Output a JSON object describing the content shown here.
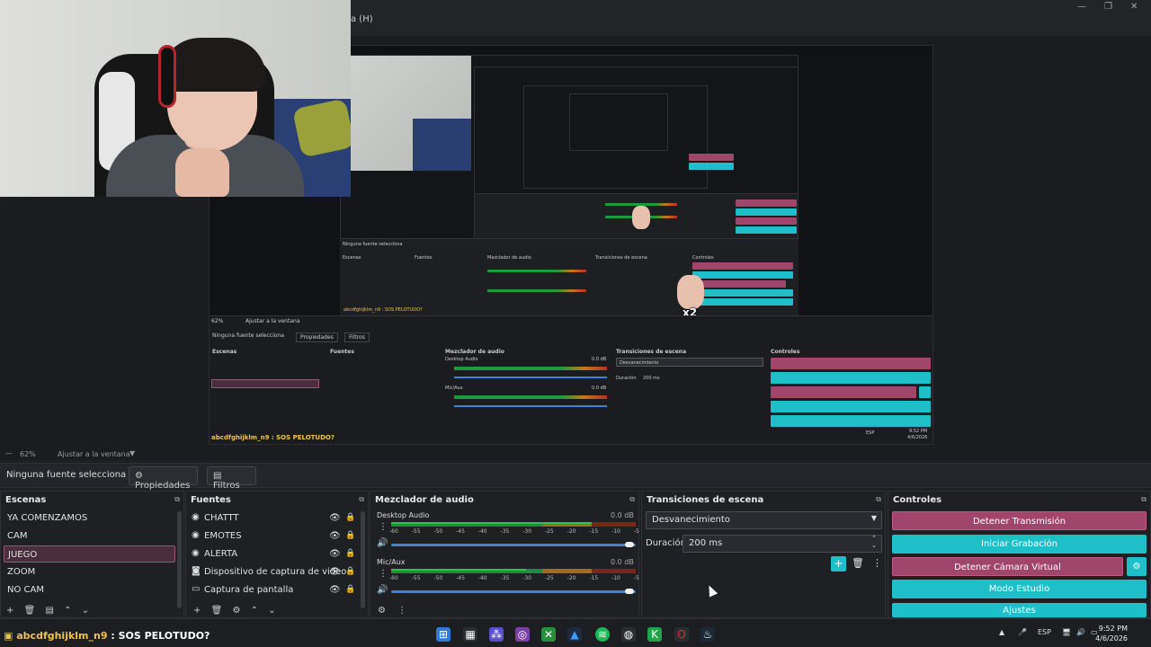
{
  "window": {
    "menu_help": "a (H)",
    "controls": [
      "—",
      "❐",
      "✕"
    ]
  },
  "zoombar": {
    "zoom": "62%",
    "fit": "Ajustar a la ventana"
  },
  "propbar": {
    "no_source": "Ninguna fuente selecciona",
    "properties": "Propiedades",
    "filters": "Filtros"
  },
  "scenes": {
    "title": "Escenas",
    "items": [
      "YA COMENZAMOS",
      "CAM",
      "JUEGO",
      "ZOOM",
      "NO CAM"
    ],
    "selected": "JUEGO"
  },
  "sources": {
    "title": "Fuentes",
    "items": [
      {
        "label": "CHATTT",
        "icon": "browser-icon"
      },
      {
        "label": "EMOTES",
        "icon": "browser-icon"
      },
      {
        "label": "ALERTA",
        "icon": "browser-icon"
      },
      {
        "label": "Dispositivo de captura de video",
        "icon": "camera-icon"
      },
      {
        "label": "Captura de pantalla",
        "icon": "monitor-icon"
      }
    ]
  },
  "mixer": {
    "title": "Mezclador de audio",
    "channels": [
      {
        "name": "Desktop Audio",
        "db": "0.0 dB",
        "level": 0.82
      },
      {
        "name": "Mic/Aux",
        "db": "0.0 dB",
        "level": 0.55
      }
    ],
    "ticks": "-60 -55 -50 -45 -40 -35 -30 -25 -20 -15 -10 -5 0"
  },
  "transitions": {
    "title": "Transiciones de escena",
    "selected": "Desvanecimiento",
    "duration_label": "Duración",
    "duration_value": "200 ms"
  },
  "controls": {
    "title": "Controles",
    "stop_stream": "Detener Transmisión",
    "start_record": "Iniciar Grabación",
    "stop_virtual_cam": "Detener Cámara Virtual",
    "studio_mode": "Modo Estudio",
    "settings": "Ajustes"
  },
  "nested": {
    "no_source": "Ninguna fuente selecciona",
    "properties": "Propiedades",
    "filters": "Filtros",
    "scenes": "Escenas",
    "sources": "Fuentes",
    "mixer": "Mezclador de audio",
    "transitions": "Transiciones de escena",
    "controls": "Controles",
    "desktop_audio": "Desktop Audio",
    "mic": "Mic/Aux",
    "db": "0.0 dB",
    "duration": "Duración",
    "duration_value": "200 ms",
    "transition": "Desvanecimiento",
    "zoom": "62%",
    "fit": "Ajustar a la ventana",
    "sticker_label": "x2",
    "chat": "abcdfghijklm_n9 : SOS PELOTUDO?",
    "clock_time": "9:52 PM",
    "clock_date": "4/6/2026",
    "lang": "ESP"
  },
  "taskbar": {
    "chat_user": "abcdfghijklm_n9",
    "chat_msg": " : SOS PELOTUDO?",
    "lang": "ESP",
    "time": "9:52 PM",
    "date": "4/6/2026"
  },
  "colors": {
    "accent_red": "#a0456b",
    "accent_cyan": "#1fbfc9",
    "selection": "#4b2e3d"
  }
}
